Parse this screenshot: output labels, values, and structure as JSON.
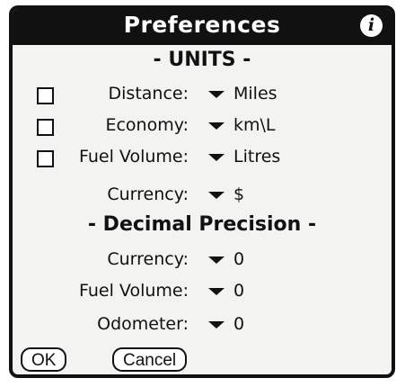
{
  "window": {
    "title": "Preferences",
    "info_icon": "info-icon"
  },
  "units": {
    "heading": "- UNITS -",
    "rows": [
      {
        "label": "Distance:",
        "value": "Miles",
        "checked": false
      },
      {
        "label": "Economy:",
        "value": "km\\L",
        "checked": false
      },
      {
        "label": "Fuel Volume:",
        "value": "Litres",
        "checked": false
      },
      {
        "label": "Currency:",
        "value": "$"
      }
    ]
  },
  "precision": {
    "heading": "- Decimal Precision -",
    "rows": [
      {
        "label": "Currency:",
        "value": "0"
      },
      {
        "label": "Fuel Volume:",
        "value": "0"
      },
      {
        "label": "Odometer:",
        "value": "0"
      }
    ]
  },
  "buttons": {
    "ok": "OK",
    "cancel": "Cancel"
  }
}
